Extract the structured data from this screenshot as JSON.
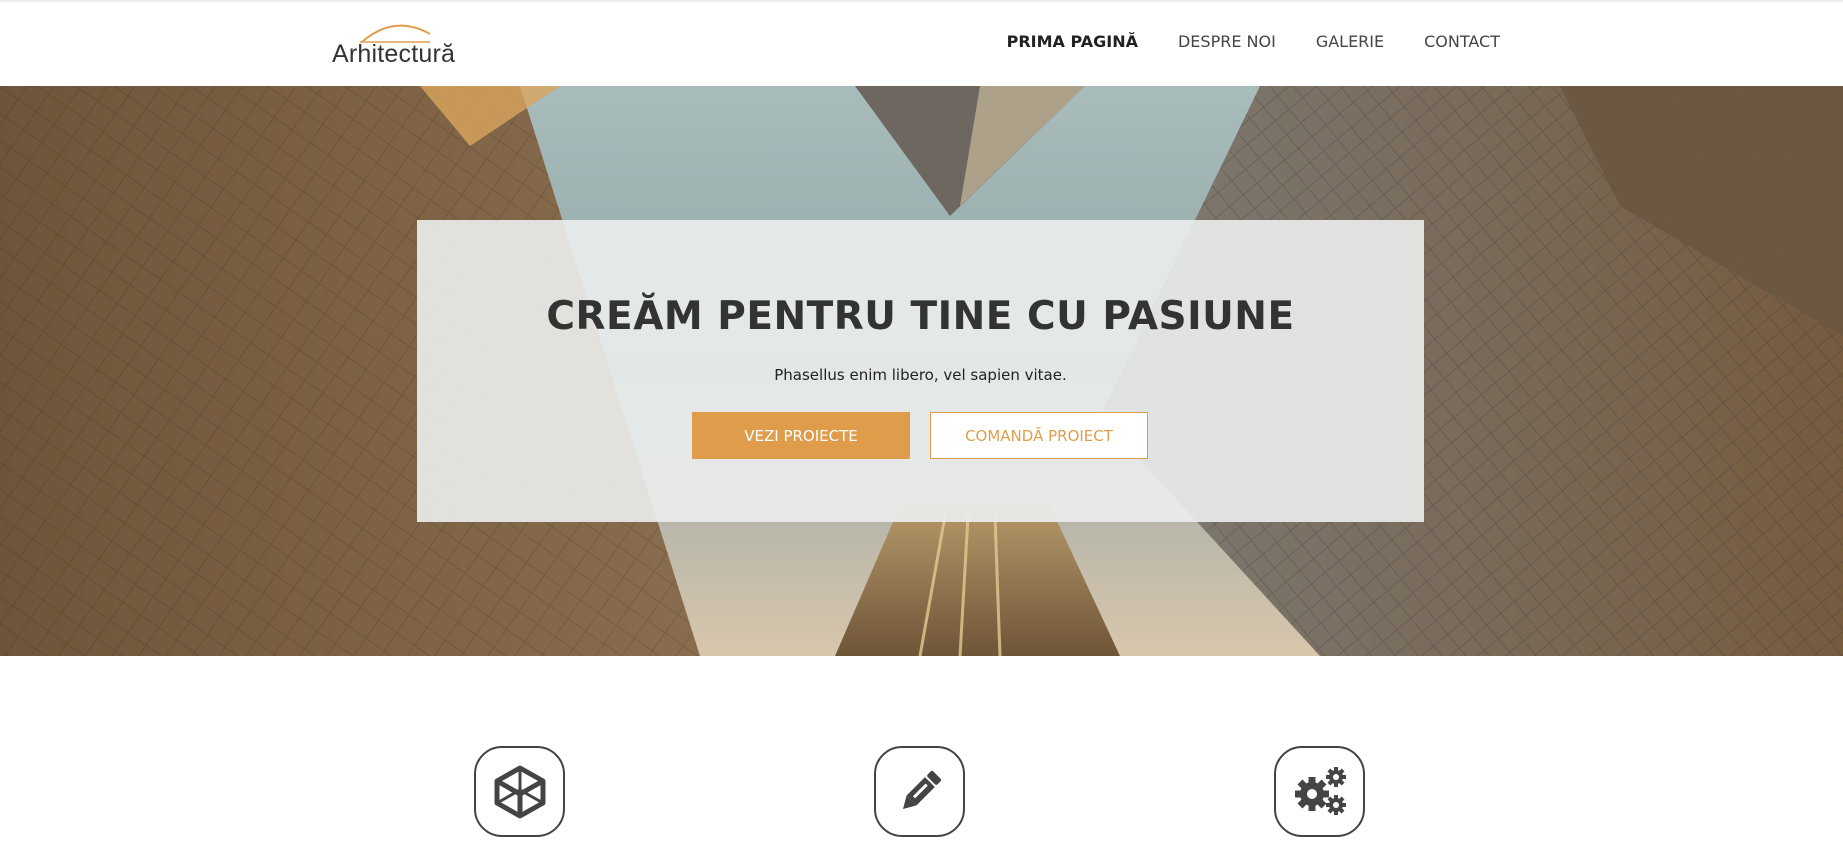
{
  "brand": {
    "name": "Arhitectură",
    "accent": "#df9d4b"
  },
  "nav": {
    "items": [
      {
        "label": "PRIMA PAGINĂ",
        "active": true
      },
      {
        "label": "DESPRE NOI",
        "active": false
      },
      {
        "label": "GALERIE",
        "active": false
      },
      {
        "label": "CONTACT",
        "active": false
      }
    ]
  },
  "hero": {
    "title": "CREĂM PENTRU TINE CU PASIUNE",
    "subtitle": "Phasellus enim libero, vel sapien vitae.",
    "primary_button": "VEZI PROIECTE",
    "secondary_button": "COMANDĂ PROIECT"
  },
  "features": [
    {
      "icon": "cube-icon"
    },
    {
      "icon": "pencil-icon"
    },
    {
      "icon": "gears-icon"
    }
  ]
}
